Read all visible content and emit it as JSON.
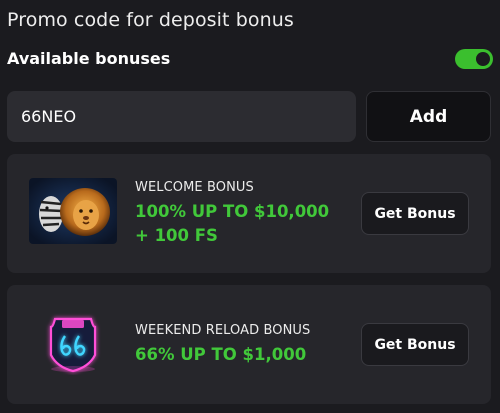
{
  "header": {
    "title": "Promo code for deposit bonus"
  },
  "available_bonuses": {
    "label": "Available bonuses",
    "toggle_on": true,
    "toggle_color": "#3bbf2e"
  },
  "promo": {
    "input_value": "66NEO",
    "add_label": "Add"
  },
  "bonuses": [
    {
      "name": "WELCOME BONUS",
      "offer": "100% UP TO $10,000 + 100 FS",
      "button_label": "Get Bonus",
      "image_icon": "lions-artwork-icon"
    },
    {
      "name": "WEEKEND RELOAD BONUS",
      "offer": "66% UP TO $1,000",
      "button_label": "Get Bonus",
      "image_icon": "route-66-neon-sign-icon"
    }
  ],
  "colors": {
    "background": "#1b1b1f",
    "card": "#26262b",
    "offer_green": "#41c83a"
  }
}
